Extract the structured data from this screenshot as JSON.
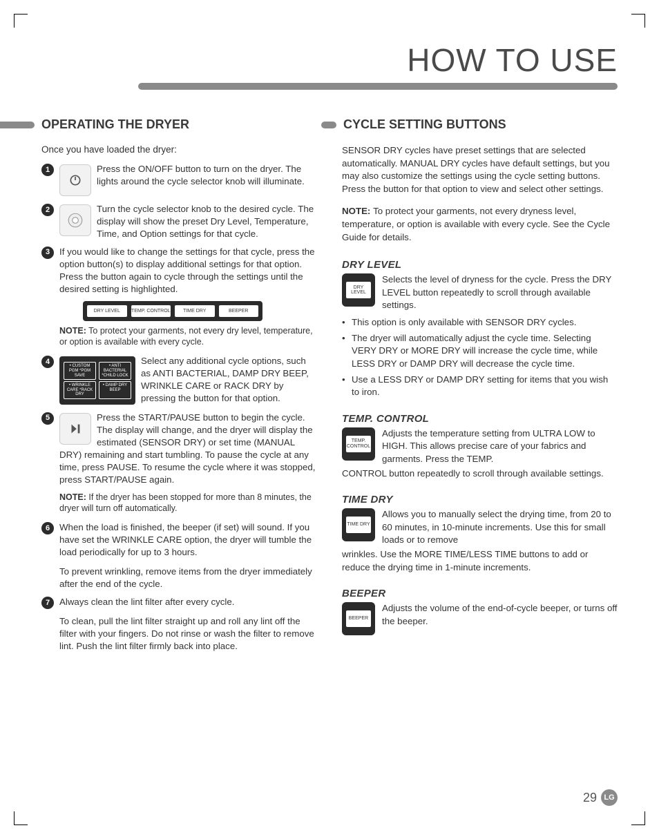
{
  "page": {
    "title": "HOW TO USE",
    "number": "29",
    "brand": "LG"
  },
  "left": {
    "heading": "OPERATING THE DRYER",
    "intro": "Once you have loaded the dryer:",
    "steps": [
      {
        "n": "1",
        "lead": "Press the ON/OFF button to turn on the ",
        "cont": "dryer. The lights around the cycle selector knob will illuminate.",
        "icon": "power-icon"
      },
      {
        "n": "2",
        "lead": "Turn the cycle selector knob to the desired ",
        "cont": "cycle. The display will show the preset Dry Level, Temperature, Time, and Option settings for that cycle.",
        "icon": "knob-icon"
      },
      {
        "n": "3",
        "lead": "If you would like to change the settings ",
        "cont": "for that cycle, press the option button(s) to display additional settings for that option. Press the button again to cycle through the settings until the desired setting is highlighted."
      },
      {
        "n": "4",
        "lead": "",
        "cont": "Select any additional cycle options, such as ANTI BACTERIAL, DAMP DRY BEEP, WRINKLE CARE or RACK DRY by pressing the button for that option.",
        "panel": true
      },
      {
        "n": "5",
        "lead": "Press the START/PAUSE button to begin the ",
        "cont": "cycle. The display will change, and the dryer will display the estimated (SENSOR DRY) or set time (MANUAL DRY) remaining and start tumbling. To pause the cycle at any time, press PAUSE. To resume the cycle where it was stopped, press START/PAUSE again.",
        "icon": "play-pause-icon"
      },
      {
        "n": "6",
        "lead": "When the load is finished, the beeper (if ",
        "cont": "set) will sound. If you have set the WRINKLE CARE option, the dryer will tumble the load periodically for up to 3 hours."
      },
      {
        "n": "7",
        "lead": "Always clean the lint filter after every cycle.",
        "cont": ""
      }
    ],
    "button_row": [
      "DRY LEVEL",
      "TEMP. CONTROL",
      "TIME DRY",
      "BEEPER"
    ],
    "note3": "NOTE: To protect your garments, not every dry level, temperature, or option is available with every cycle.",
    "panel_cells": [
      "• CUSTOM PGM *PGM SAVE",
      "• ANTI BACTERIAL *CHILD LOCK",
      "• WRINKLE CARE *RACK DRY",
      "• DAMP DRY BEEP"
    ],
    "note5": "NOTE: If the dryer has been stopped for more than 8 minutes, the dryer will turn off automatically.",
    "post6": "To prevent wrinkling, remove items from the dryer immediately after the end of the cycle.",
    "post7": "To clean, pull the lint filter straight up and roll any lint off the filter with your fingers. Do not rinse or wash the filter to remove lint. Push the lint filter firmly back into place."
  },
  "right": {
    "heading": "CYCLE SETTING BUTTONS",
    "intro": "SENSOR DRY cycles have preset settings that are selected automatically. MANUAL DRY cycles have default settings, but you may also customize the settings using the cycle setting buttons. Press the button for that option to view and select other settings.",
    "note": "To protect your garments, not every dryness level, temperature, or option is available with every cycle. See the Cycle Guide for details.",
    "note_label": "NOTE: ",
    "sections": {
      "dry": {
        "title": "DRY LEVEL",
        "btn": "DRY LEVEL",
        "desc": "Selects the level of dryness for the cycle. Press the DRY LEVEL button repeatedly to scroll through available settings.",
        "bullets": [
          "This option is only available with SENSOR DRY cycles.",
          "The dryer will automatically adjust the cycle time. Selecting VERY DRY or MORE DRY will increase the cycle time, while LESS DRY or DAMP DRY will decrease the cycle time.",
          "Use a LESS DRY or DAMP DRY setting for items that you wish to iron."
        ]
      },
      "temp": {
        "title": "TEMP. CONTROL",
        "btn": "TEMP. CONTROL",
        "desc": "Adjusts the temperature setting from ULTRA LOW to HIGH. This allows precise care of your fabrics and garments. Press the TEMP. ",
        "cont": "CONTROL button repeatedly to scroll through available settings."
      },
      "time": {
        "title": "TIME DRY",
        "btn": "TIME DRY",
        "desc": "Allows you to manually select the drying time, from 20 to 60 minutes, in 10-minute increments. Use this for small loads or to remove ",
        "cont": "wrinkles. Use the MORE TIME/LESS TIME buttons to add or reduce the drying time in 1-minute increments."
      },
      "beeper": {
        "title": "BEEPER",
        "btn": "BEEPER",
        "desc": "Adjusts the volume of the end-of-cycle beeper, or turns off the beeper."
      }
    }
  }
}
